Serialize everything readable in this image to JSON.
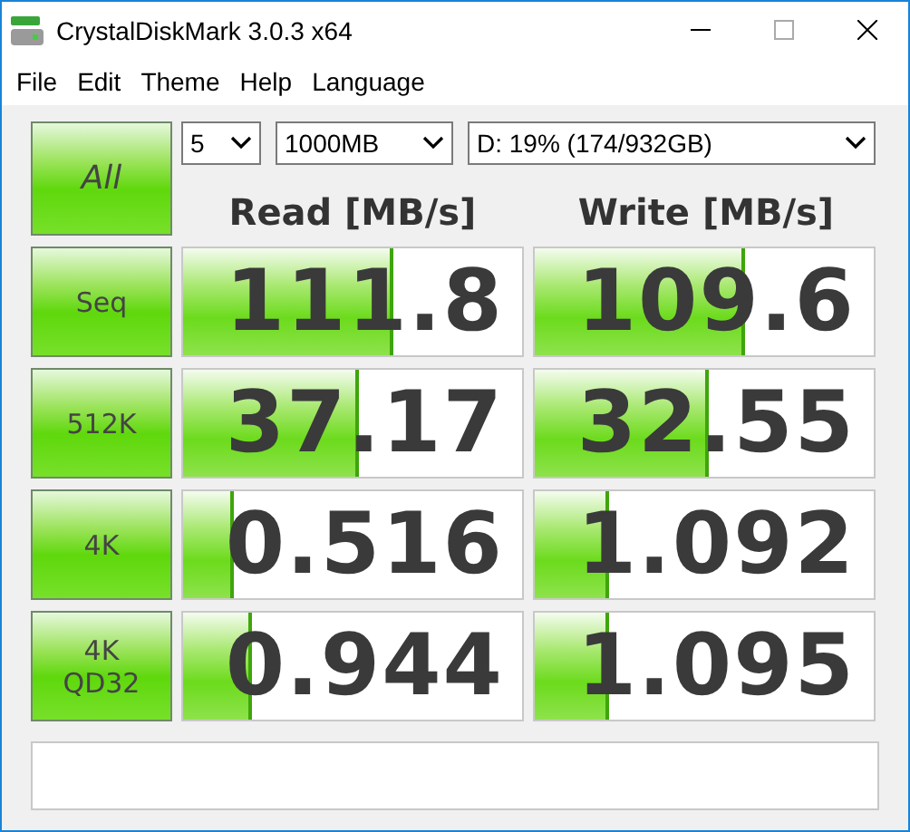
{
  "window": {
    "title": "CrystalDiskMark 3.0.3 x64"
  },
  "menu": [
    "File",
    "Edit",
    "Theme",
    "Help",
    "Language"
  ],
  "all_button": "All",
  "selectors": [
    {
      "value": "5"
    },
    {
      "value": "1000MB"
    },
    {
      "value": "D: 19% (174/932GB)"
    }
  ],
  "columns": [
    "Read [MB/s]",
    "Write [MB/s]"
  ],
  "rows": [
    {
      "label": "Seq",
      "read": {
        "value": "111.8",
        "level": 0.61
      },
      "write": {
        "value": "109.6",
        "level": 0.61
      }
    },
    {
      "label": "512K",
      "read": {
        "value": "37.17",
        "level": 0.51
      },
      "write": {
        "value": "32.55",
        "level": 0.5
      }
    },
    {
      "label": "4K",
      "read": {
        "value": "0.516",
        "level": 0.14
      },
      "write": {
        "value": "1.092",
        "level": 0.21
      }
    },
    {
      "label": "4K QD32",
      "read": {
        "value": "0.944",
        "level": 0.19
      },
      "write": {
        "value": "1.095",
        "level": 0.21
      }
    }
  ]
}
